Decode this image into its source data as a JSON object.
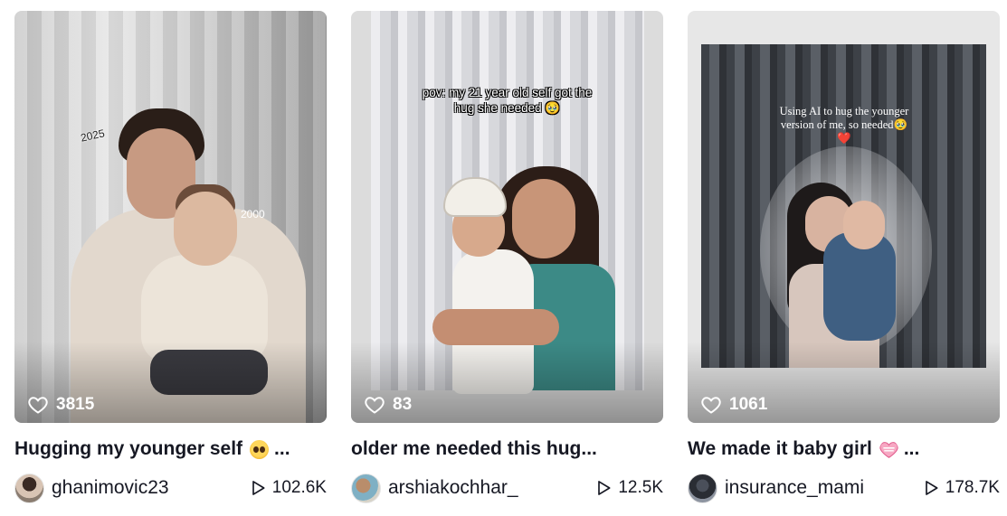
{
  "cards": [
    {
      "likes": "3815",
      "title": "Hugging my younger self",
      "title_suffix": "...",
      "title_emoji": "pleading-face-emoji",
      "author": "ghanimovic23",
      "views": "102.6K",
      "overlay": {
        "label_a": "2025",
        "label_b": "2000"
      }
    },
    {
      "likes": "83",
      "title": "older me needed this hug...",
      "author": "arshiakochhar_",
      "views": "12.5K",
      "caption": "pov: my 21 year old self got the hug she needed 🥹"
    },
    {
      "likes": "1061",
      "title": "We made it baby girl",
      "title_suffix": "...",
      "title_emoji": "heart-emoji",
      "author": "insurance_mami",
      "views": "178.7K",
      "caption": "Using AI to hug the younger version of me, so needed🥹❤️"
    }
  ],
  "icons": {
    "likes": "heart-outline-icon",
    "views": "play-outline-icon"
  },
  "colors": {
    "text": "#161823",
    "overlay_text": "#ffffff"
  }
}
